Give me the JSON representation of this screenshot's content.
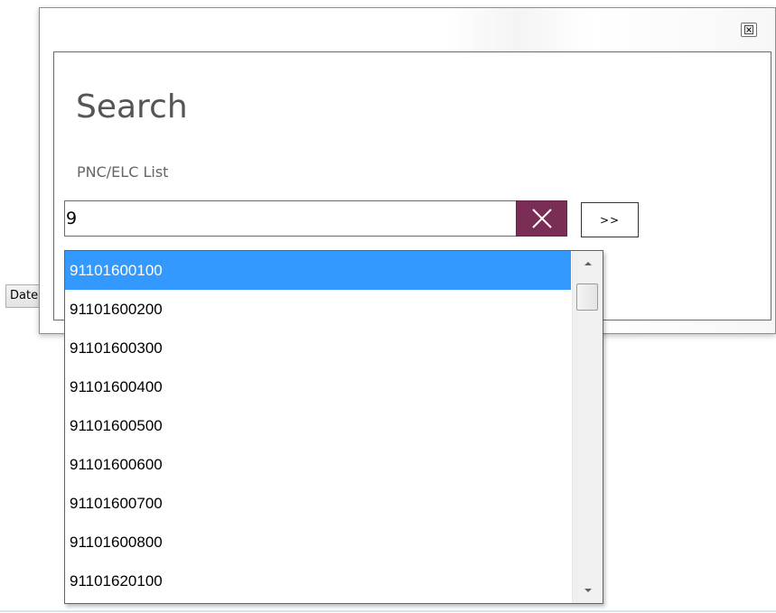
{
  "background": {
    "date_button_label": "Date"
  },
  "dialog": {
    "close_icon": "close-icon",
    "title": "Search",
    "field_label": "PNC/ELC List",
    "search": {
      "value": "9"
    },
    "clear_icon": "x-icon",
    "go_label": ">>"
  },
  "dropdown": {
    "items": [
      "91101600100",
      "91101600200",
      "91101600300",
      "91101600400",
      "91101600500",
      "91101600600",
      "91101600700",
      "91101600800",
      "91101620100"
    ],
    "selected_index": 0
  },
  "colors": {
    "accent_clear": "#7b2e55",
    "selection": "#3399ff",
    "title_text": "#555555"
  }
}
